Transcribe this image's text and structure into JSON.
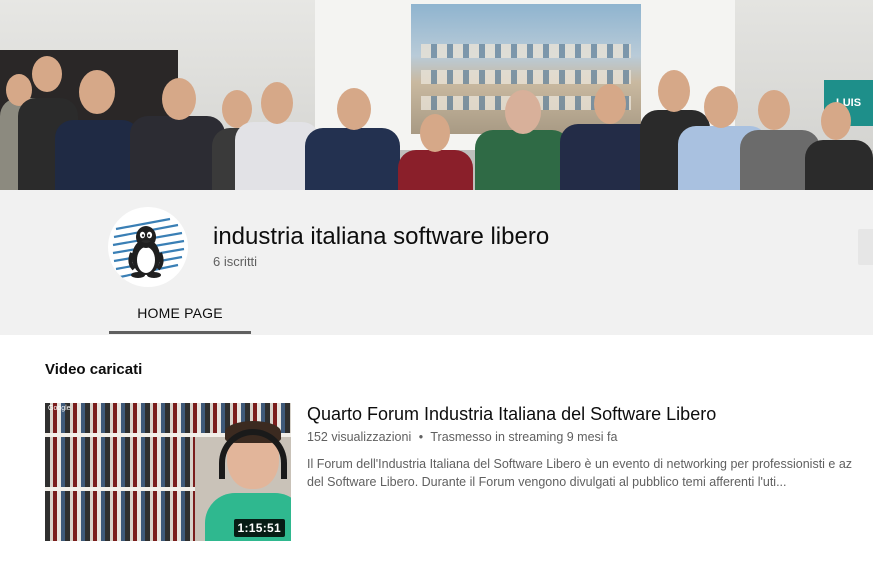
{
  "colors": {
    "header_bg": "#f1f1f1",
    "content_bg": "#ffffff",
    "text_primary": "#0d0d0d",
    "text_secondary": "#606060",
    "tab_underline": "#606060",
    "duration_bg": "#000000",
    "avatar_logo_blue": "#3a7fb5"
  },
  "banner": {
    "sign_text": "LUIS"
  },
  "channel": {
    "name": "industria italiana software libero",
    "subscribers": "6 iscritti",
    "avatar_icon": "tux-penguin-icon"
  },
  "tabs": [
    {
      "label": "HOME PAGE",
      "selected": true
    }
  ],
  "section": {
    "title": "Video caricati"
  },
  "video": {
    "title": "Quarto Forum Industria Italiana del Software Libero",
    "views": "152 visualizzazioni",
    "separator": "•",
    "streamed": "Trasmesso in streaming 9 mesi fa",
    "description_line1": "Il Forum dell'Industria Italiana del Software Libero è un evento di networking per professionisti e az",
    "description_line2": "del Software Libero. Durante il Forum vengono divulgati al pubblico temi afferenti l'uti...",
    "duration": "1:15:51",
    "thumb_corner_text": "Google"
  }
}
